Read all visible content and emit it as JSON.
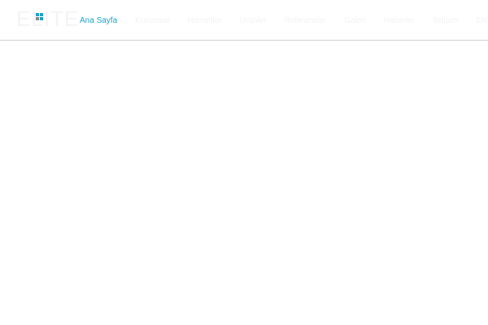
{
  "header": {
    "logo": {
      "text": "ELITE",
      "icon": "grid-squares-icon",
      "colors": {
        "square_1": "#1aa3c9",
        "square_2": "#1aa3c9",
        "square_3": "#8a8a8a",
        "square_4": "#1aa3c9"
      }
    },
    "nav": {
      "items": [
        {
          "label": "Ana Sayfa",
          "active": true
        },
        {
          "label": "Kurumsal",
          "active": false
        },
        {
          "label": "Hizmetler",
          "active": false
        },
        {
          "label": "Ürünler",
          "active": false
        },
        {
          "label": "Referanslar",
          "active": false
        },
        {
          "label": "Galeri",
          "active": false
        },
        {
          "label": "Haberler",
          "active": false
        },
        {
          "label": "İletişim",
          "active": false
        },
        {
          "label": "EN",
          "active": false
        }
      ]
    }
  },
  "theme": {
    "accent": "#1aa3c9",
    "border": "#cfcfcf",
    "background": "#ffffff"
  }
}
